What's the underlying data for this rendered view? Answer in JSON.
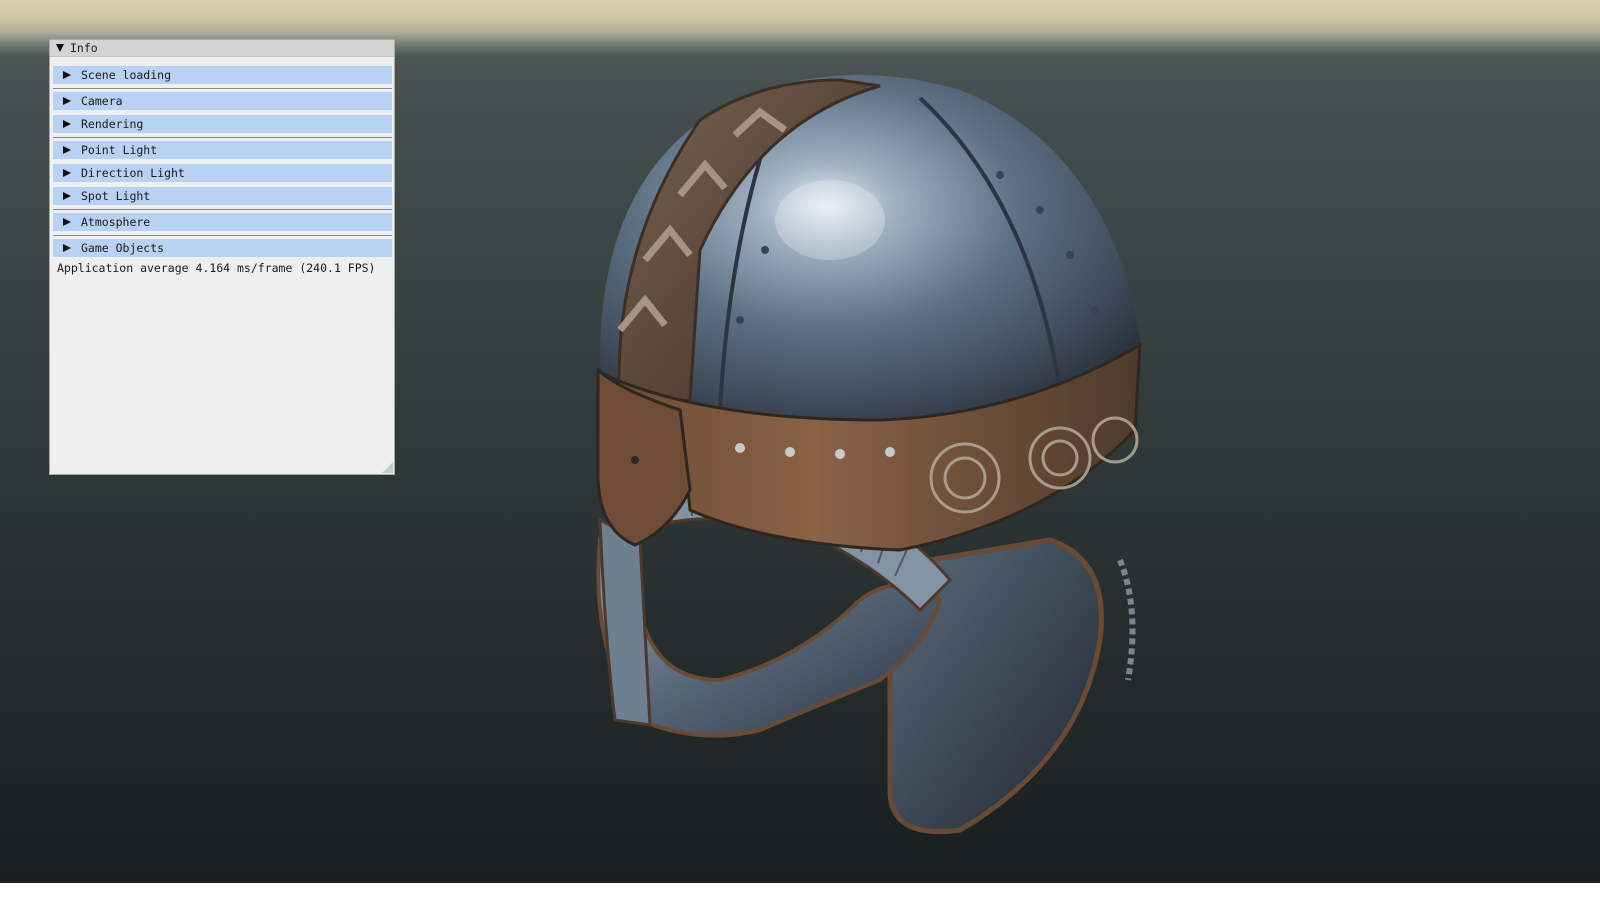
{
  "window": {
    "title": "Info",
    "headers": [
      {
        "label": "Scene loading"
      },
      {
        "label": "Camera"
      },
      {
        "label": "Rendering"
      },
      {
        "label": "Point Light"
      },
      {
        "label": "Direction Light"
      },
      {
        "label": "Spot Light"
      },
      {
        "label": "Atmosphere"
      },
      {
        "label": "Game Objects"
      }
    ],
    "status_text": "Application average 4.164 ms/frame (240.1 FPS)"
  },
  "colors": {
    "header_bg": "#b7d2f2",
    "window_bg": "#efefef",
    "titlebar_bg": "#d4d4d4"
  },
  "icons": {
    "collapse": "triangle-down-icon",
    "expand": "triangle-right-icon",
    "resize": "resize-grip-icon"
  }
}
